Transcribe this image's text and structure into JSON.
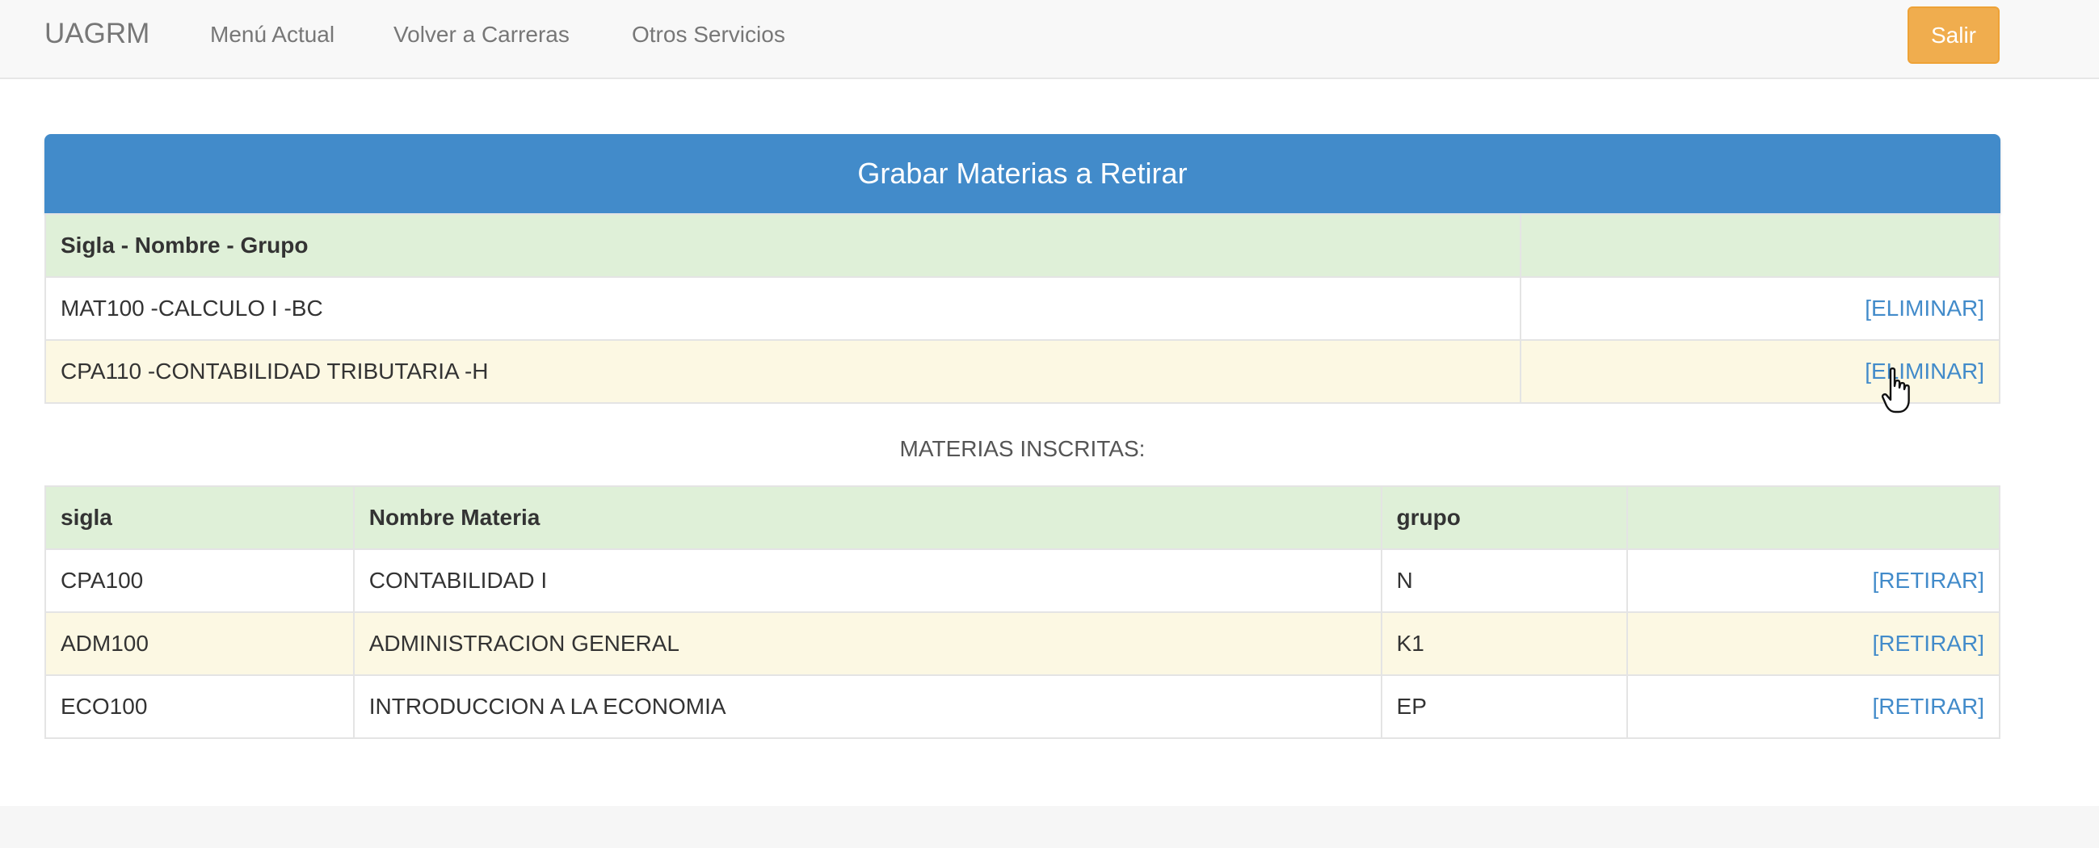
{
  "navbar": {
    "brand": "UAGRM",
    "links": [
      "Menú Actual",
      "Volver a Carreras",
      "Otros Servicios"
    ],
    "logout_label": "Salir"
  },
  "retiro": {
    "title": "Grabar Materias a Retirar",
    "header": "Sigla - Nombre - Grupo",
    "rows": [
      {
        "text": "MAT100 -CALCULO I -BC",
        "action": "[ELIMINAR]"
      },
      {
        "text": "CPA110 -CONTABILIDAD TRIBUTARIA -H",
        "action": "[ELIMINAR]"
      }
    ]
  },
  "inscritas": {
    "title": "MATERIAS INSCRITAS:",
    "columns": [
      "sigla",
      "Nombre Materia",
      "grupo"
    ],
    "rows": [
      {
        "sigla": "CPA100",
        "nombre": "CONTABILIDAD I",
        "grupo": "N",
        "action": "[RETIRAR]"
      },
      {
        "sigla": "ADM100",
        "nombre": "ADMINISTRACION GENERAL",
        "grupo": "K1",
        "action": "[RETIRAR]"
      },
      {
        "sigla": "ECO100",
        "nombre": "INTRODUCCION A LA ECONOMIA",
        "grupo": "EP",
        "action": "[RETIRAR]"
      }
    ]
  },
  "colors": {
    "header_blue": "#428bca",
    "row_green": "#dff0d8",
    "row_yellow": "#fcf8e3",
    "button_orange": "#f0ad4e"
  },
  "icons": {
    "cursor": "hand-pointer-icon"
  }
}
